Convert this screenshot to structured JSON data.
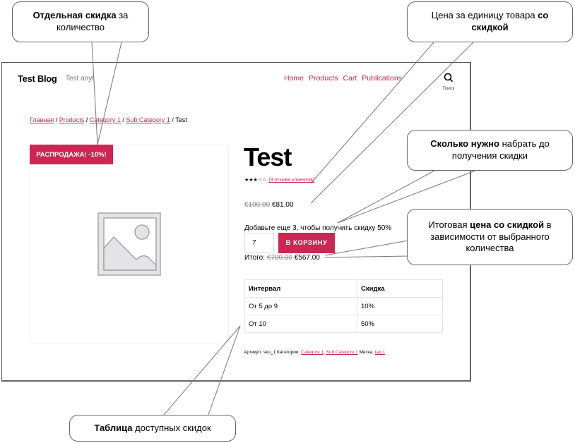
{
  "site": {
    "title": "Test Blog",
    "description": "Test anyt",
    "nav": [
      "Home",
      "Products",
      "Cart",
      "Publications"
    ],
    "search_label": "Поиск"
  },
  "breadcrumb": {
    "items": [
      "Главная",
      "Products",
      "Category 1",
      "Sub Category 1"
    ],
    "current": "Test",
    "separator": " / "
  },
  "product": {
    "sale_badge": "РАСПРОДАЖА! -10%!",
    "title": "Test",
    "rating": {
      "value": 3,
      "max": 5,
      "stars": "★★★☆☆"
    },
    "reviews_link": "(3 отзыва клиентов)",
    "old_price": "€100.00",
    "price": "€81.00",
    "hint": "Добавьте еще 3, чтобы получить скидку 50%",
    "quantity": "7",
    "add_to_cart": "В КОРЗИНУ",
    "total_label": "Итого:",
    "total_old": "€700.00",
    "total_new": "€567.00",
    "image_icon": "placeholder-image-icon"
  },
  "discount_table": {
    "headers": [
      "Интервал",
      "Скидка"
    ],
    "rows": [
      [
        "От 5 до 9",
        "10%"
      ],
      [
        "От 10",
        "50%"
      ]
    ]
  },
  "meta": {
    "sku_label": "Артикул:",
    "sku": "sku_1",
    "categories_label": "Категории:",
    "categories": [
      "Category 1",
      "Sub Category 1"
    ],
    "tag_label": "Метка:",
    "tag": "tag 1"
  },
  "callouts": {
    "c1": {
      "bold": "Отдельная скидка",
      "rest": " за количество"
    },
    "c2": {
      "pre": "Цена за единицу товара ",
      "bold": "со скидкой"
    },
    "c3": {
      "bold": "Сколько нужно",
      "rest": " набрать до получения скидки"
    },
    "c4": {
      "pre": "Итоговая ",
      "bold": "цена со скидкой",
      "rest": " в зависимости от выбранного количества"
    },
    "c5": {
      "bold": "Таблица",
      "rest": " доступных скидок"
    }
  },
  "colors": {
    "accent": "#cd2653"
  }
}
